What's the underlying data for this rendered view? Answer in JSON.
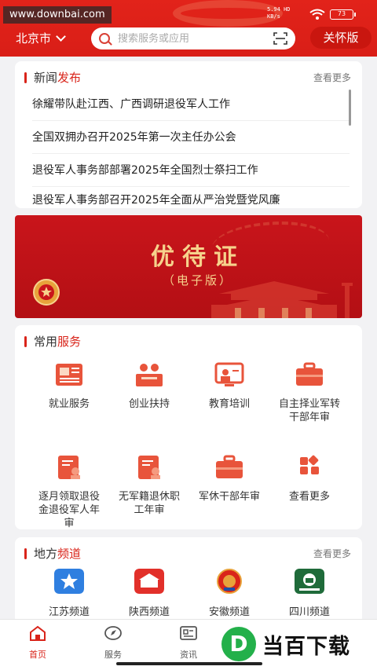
{
  "status_bar": {
    "watermark": "www.downbai.com",
    "net_speed": "5.94",
    "net_unit": "KB/s",
    "net_type": "HD",
    "battery": "73"
  },
  "header": {
    "city": "北京市",
    "search_placeholder": "搜索服务或应用",
    "care_mode": "关怀版"
  },
  "news": {
    "title_plain": "新闻",
    "title_highlight": "发布",
    "more": "查看更多",
    "items": [
      "徐耀带队赴江西、广西调研退役军人工作",
      "全国双拥办召开2025年第一次主任办公会",
      "退役军人事务部部署2025年全国烈士祭扫工作",
      "退役军人事务部召开2025年全面从严治党暨党风廉"
    ]
  },
  "banner": {
    "title": "优待证",
    "subtitle": "（电子版）"
  },
  "services": {
    "title_plain": "常用",
    "title_highlight": "服务",
    "items": [
      {
        "label": "就业服务",
        "icon": "newspaper-icon"
      },
      {
        "label": "创业扶持",
        "icon": "presenter-icon"
      },
      {
        "label": "教育培训",
        "icon": "teaching-board-icon"
      },
      {
        "label": "自主择业军转干部年审",
        "icon": "briefcase-icon"
      },
      {
        "label": "逐月领取退役金退役军人年审",
        "icon": "document-person-icon"
      },
      {
        "label": "无军籍退休职工年审",
        "icon": "document-person-icon"
      },
      {
        "label": "军休干部年审",
        "icon": "briefcase-icon"
      },
      {
        "label": "查看更多",
        "icon": "grid-more-icon"
      }
    ]
  },
  "local": {
    "title_plain": "地方",
    "title_highlight": "频道",
    "more": "查看更多",
    "items": [
      {
        "label": "江苏频道",
        "icon": "jiangsu-logo-icon"
      },
      {
        "label": "陕西频道",
        "icon": "shaanxi-logo-icon"
      },
      {
        "label": "安徽频道",
        "icon": "anhui-emblem-icon"
      },
      {
        "label": "四川频道",
        "icon": "sichuan-logo-icon"
      }
    ]
  },
  "tabbar": {
    "items": [
      {
        "label": "首页",
        "icon": "home-icon"
      },
      {
        "label": "服务",
        "icon": "compass-icon"
      },
      {
        "label": "资讯",
        "icon": "news-icon"
      }
    ]
  },
  "brand_watermark": {
    "logo_letter": "D",
    "text": "当百下载"
  },
  "colors": {
    "primary": "#d9241a",
    "banner": "#c9151b",
    "gold": "#f6d28c"
  }
}
